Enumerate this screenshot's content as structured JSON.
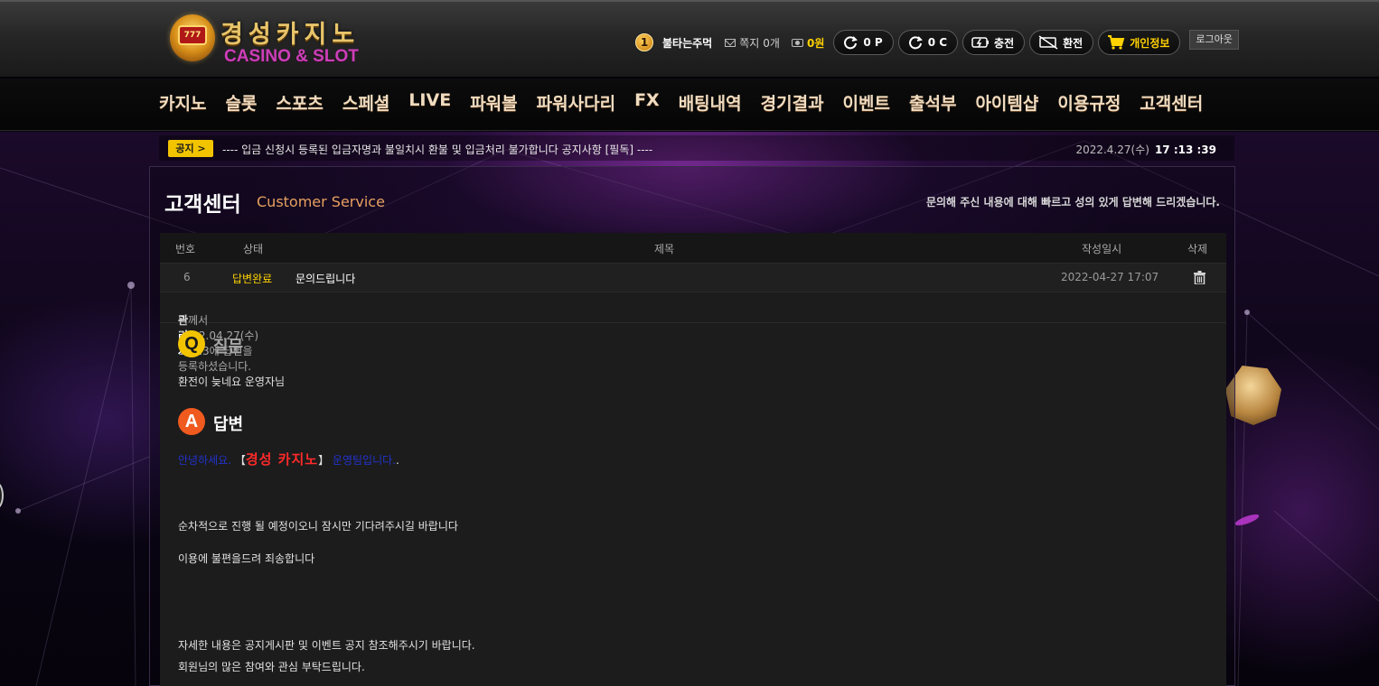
{
  "site": {
    "logo_emblem_text": "777",
    "logo_title": "경성카지노",
    "logo_subtitle": "CASINO & SLOT"
  },
  "user": {
    "level": "1",
    "username": "불타는주먹",
    "messages_label": "쪽지",
    "messages_count": "0개",
    "cash": "0원",
    "point_label": "0 P",
    "comp_label": "0 C",
    "charge_label": "충전",
    "exchange_label": "환전",
    "profile_label": "개인정보",
    "logout_label": "로그아웃"
  },
  "nav": {
    "items": [
      "카지노",
      "슬롯",
      "스포츠",
      "스페셜",
      "LIVE",
      "파워볼",
      "파워사다리",
      "FX",
      "배팅내역",
      "경기결과",
      "이벤트",
      "출석부",
      "아이템샵",
      "이용규정",
      "고객센터"
    ]
  },
  "notice": {
    "tag": "공지 >",
    "text": "---- 입금 신청시 등록된 입금자명과 불일치시 환불 및 입금처리 불가합니다 공지사항 [필독] ----",
    "date": "2022.4.27(수)",
    "time": "17 :13 :39"
  },
  "page": {
    "title": "고객센터",
    "subtitle": "Customer Service",
    "description": "문의해 주신 내용에 대해 빠르고 성의 있게 답변해 드리겠습니다."
  },
  "table": {
    "headers": {
      "no": "번호",
      "status": "상태",
      "subject": "제목",
      "date": "작성일시",
      "delete": "삭제"
    },
    "row": {
      "no": "6",
      "status": "답변완료",
      "subject": "문의드립니다",
      "date": "2022-04-27 17:07"
    }
  },
  "answer_meta": {
    "admin": "관리자",
    "text": "님께서 2022.04.27(수) 17:13에 답변을 등록하셨습니다."
  },
  "question": {
    "icon": "Q",
    "label": "질문",
    "text": "환전이 늦네요 운영자님"
  },
  "answer": {
    "icon": "A",
    "label": "답변",
    "greeting_pre": "안녕하세요.",
    "greeting_open": " 【",
    "greeting_name": "경성 카지노",
    "greeting_close": "】",
    "greeting_post": " 운영팀입니다.",
    "greeting_end": ".",
    "line1": "순차적으로 진행 될 예정이오니 잠시만 기다려주시길 바랍니다",
    "line2": "이용에 불편을드려 죄송합니다",
    "line3": "자세한 내용은 공지게시판 및 이벤트 공지 참조해주시기 바랍니다.",
    "line4": "회원님의 많은 참여와 관심 부탁드립니다."
  },
  "colors": {
    "accent_gold": "#ffd200",
    "status_answered": "#ffd200",
    "question_icon": "#f2c400",
    "answer_icon": "#f05a1e"
  }
}
